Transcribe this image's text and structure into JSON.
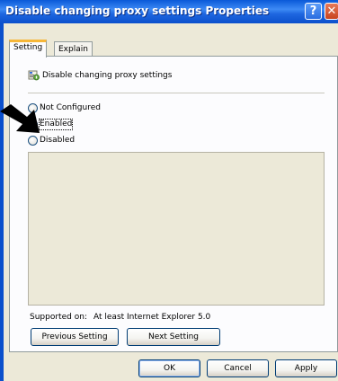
{
  "window": {
    "title": "Disable changing proxy settings Properties",
    "help_glyph": "?",
    "close_glyph": "✕"
  },
  "tabs": [
    {
      "label": "Setting",
      "active": true
    },
    {
      "label": "Explain",
      "active": false
    }
  ],
  "setting": {
    "policy_title": "Disable changing proxy settings",
    "policy_icon": "policy-setting-icon",
    "options": [
      {
        "label": "Not Configured",
        "checked": false
      },
      {
        "label": "Enabled",
        "checked": true
      },
      {
        "label": "Disabled",
        "checked": false
      }
    ],
    "supported_label": "Supported on:",
    "supported_value": "At least Internet Explorer 5.0",
    "prev_button": "Previous Setting",
    "next_button": "Next Setting"
  },
  "footer": {
    "ok": "OK",
    "cancel": "Cancel",
    "apply": "Apply"
  },
  "annotation": {
    "icon": "pointer-arrow-icon",
    "color": "#000000"
  },
  "colors": {
    "titlebar": "#0b50cc",
    "dialog_background": "#ece9d8",
    "tab_accent": "#f7b738",
    "radio_dot": "#21a121"
  }
}
